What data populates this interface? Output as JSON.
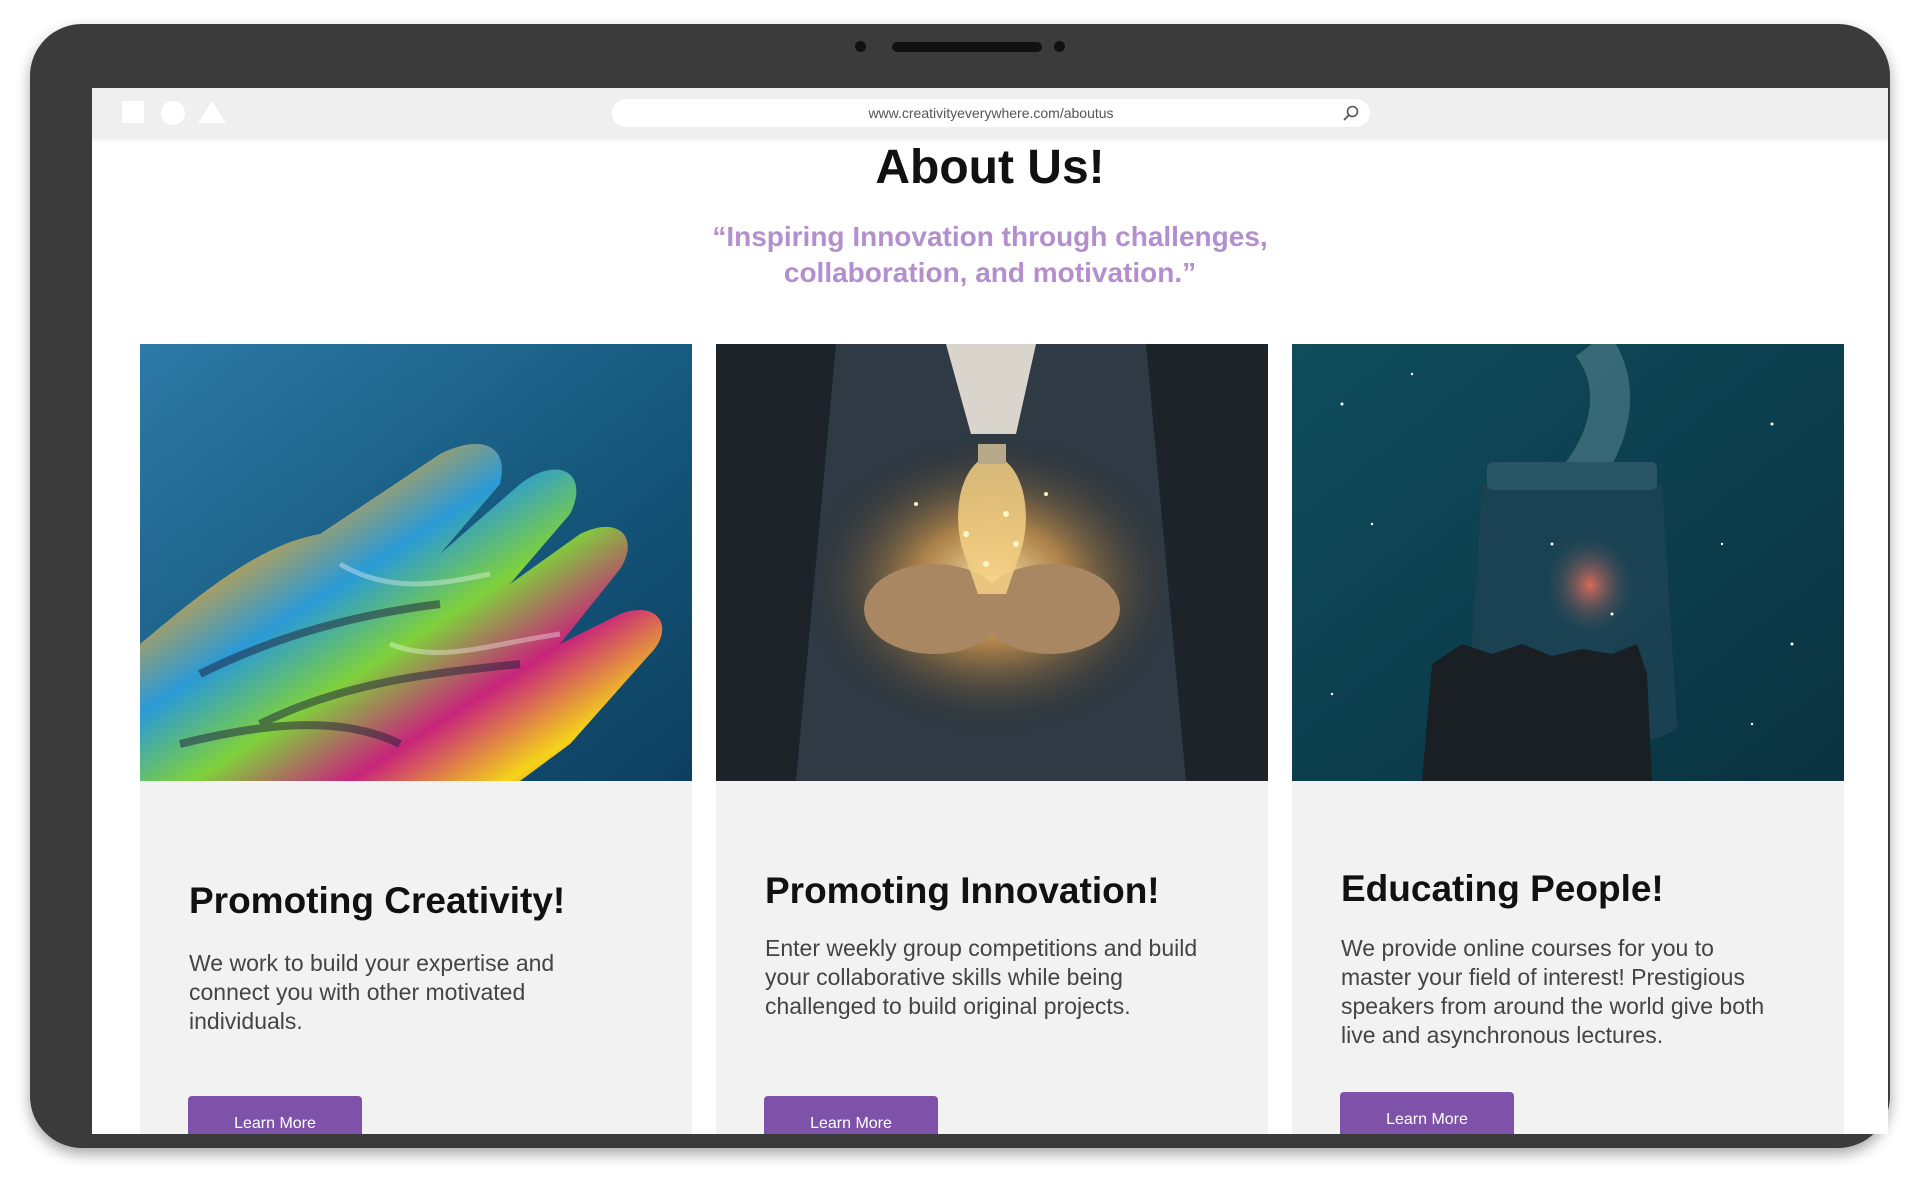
{
  "browser": {
    "url": "www.creativityeverywhere.com/aboutus"
  },
  "page": {
    "heading": "About Us!",
    "tagline_line1": "“Inspiring Innovation through challenges,",
    "tagline_line2": "collaboration, and motivation.”"
  },
  "cards": [
    {
      "image": "painted-hand-image",
      "title": "Promoting Creativity!",
      "text": "We work to build your expertise and connect you with other motivated individuals.",
      "button": "Learn More"
    },
    {
      "image": "lightbulb-hands-image",
      "title": "Promoting Innovation!",
      "text": "Enter weekly group competitions and build your collaborative skills while being challenged to build original projects.",
      "button": "Learn More"
    },
    {
      "image": "galaxy-jar-image",
      "title": "Educating People!",
      "text": "We provide online courses for you to master your field of interest! Prestigious speakers from around the world give both live and asynchronous lectures.",
      "button": "Learn More"
    }
  ],
  "colors": {
    "accent_purple": "#7d52a8",
    "tagline_lavender": "#b38fcd",
    "device_frame": "#3b3b3b",
    "card_background": "#f2f2f2"
  },
  "icons": {
    "browser_shapes": [
      "square-icon",
      "circle-icon",
      "triangle-icon"
    ],
    "search": "search-icon"
  }
}
